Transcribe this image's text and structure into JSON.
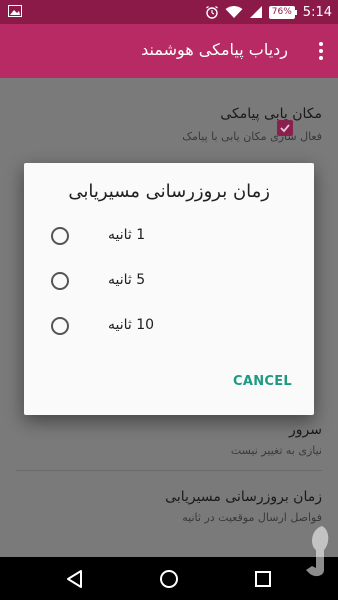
{
  "status_bar": {
    "battery_percent": "76%",
    "time": "5:14",
    "icons": [
      "image-icon",
      "alarm-icon",
      "wifi-icon",
      "signal-icon",
      "battery-icon"
    ]
  },
  "app_bar": {
    "title": "ردیاب پیامکی هوشمند",
    "menu_icon": "overflow-menu-icon"
  },
  "preferences": [
    {
      "title": "مکان یابی پیامکی",
      "summary": "فعال سازی مکان یابی با پیامک",
      "checked": true
    },
    {
      "title": "سرور",
      "summary": "نیازی به تغییر نیست"
    },
    {
      "title": "زمان بروزرسانی مسیریابی",
      "summary": "فواصل ارسال موقعیت در ثانیه"
    }
  ],
  "dialog": {
    "title": "زمان بروزرسانی مسیریابی",
    "options": [
      {
        "label": "1 ثانیه",
        "selected": false
      },
      {
        "label": "5 ثانیه",
        "selected": false
      },
      {
        "label": "10 ثانیه",
        "selected": false
      }
    ],
    "cancel_label": "CANCEL"
  },
  "colors": {
    "status_bar": "#8c1a49",
    "app_bar": "#b82a63",
    "accent": "#1f9a82",
    "checkbox": "#8a2050"
  },
  "nav_bar": {
    "icons": [
      "back-icon",
      "home-icon",
      "recents-icon"
    ]
  }
}
